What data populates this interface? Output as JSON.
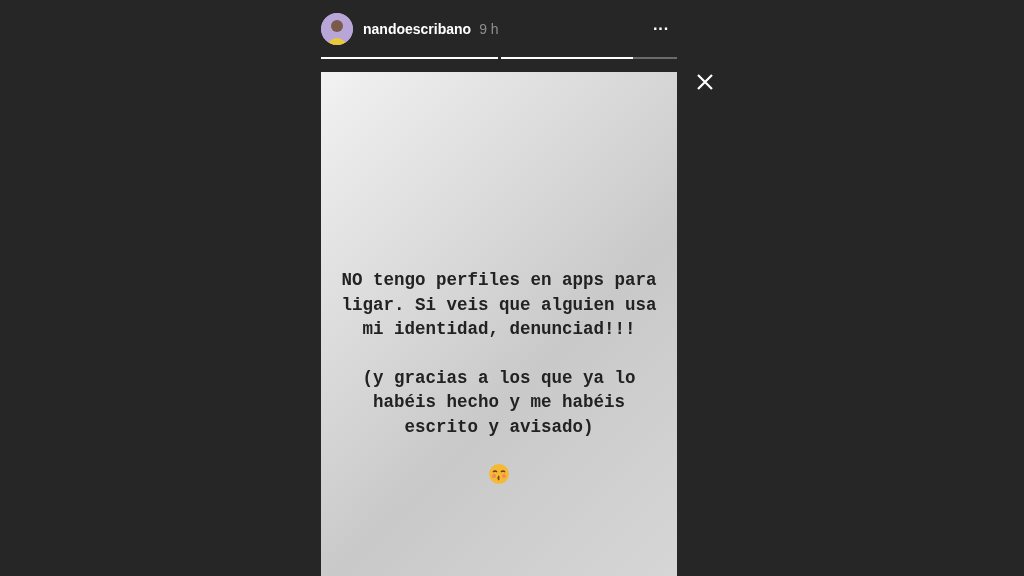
{
  "story": {
    "username": "nandoescribano",
    "time": "9 h",
    "more": "···",
    "progress": [
      {
        "level": 1
      },
      {
        "level": 0.75
      }
    ],
    "paragraphs": [
      "NO tengo perfiles en apps para ligar. Si veis que alguien usa mi identidad, denunciad!!!",
      "(y gracias a los que ya lo habéis hecho y me habéis escrito y avisado)"
    ]
  }
}
